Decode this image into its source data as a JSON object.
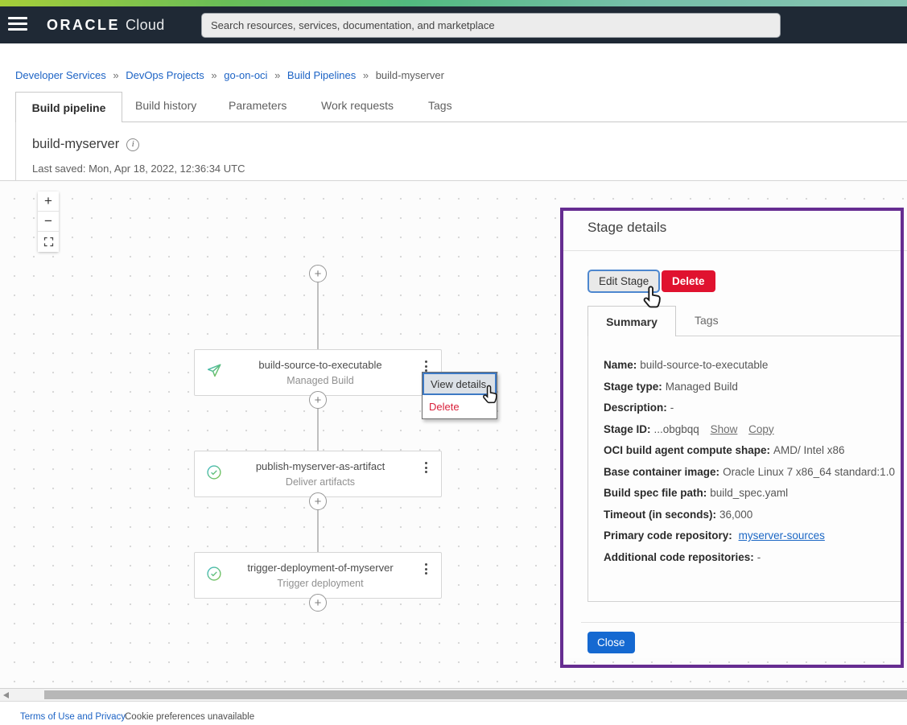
{
  "header": {
    "logo_primary": "ORACLE",
    "logo_secondary": "Cloud",
    "search_placeholder": "Search resources, services, documentation, and marketplace"
  },
  "breadcrumb": {
    "separator": "»",
    "links": [
      "Developer Services",
      "DevOps Projects",
      "go-on-oci",
      "Build Pipelines"
    ],
    "current": "build-myserver"
  },
  "tabs": [
    {
      "label": "Build pipeline",
      "active": true
    },
    {
      "label": "Build history",
      "active": false
    },
    {
      "label": "Parameters",
      "active": false
    },
    {
      "label": "Work requests",
      "active": false
    },
    {
      "label": "Tags",
      "active": false
    }
  ],
  "page": {
    "title": "build-myserver",
    "last_saved": "Last saved: Mon, Apr 18, 2022, 12:36:34 UTC"
  },
  "canvas": {
    "zoom_in": "+",
    "zoom_out": "−"
  },
  "pipeline": {
    "stages": [
      {
        "name": "build-source-to-executable",
        "type": "Managed Build",
        "icon": "send-icon"
      },
      {
        "name": "publish-myserver-as-artifact",
        "type": "Deliver artifacts",
        "icon": "check-circle-icon"
      },
      {
        "name": "trigger-deployment-of-myserver",
        "type": "Trigger deployment",
        "icon": "check-circle-icon"
      }
    ]
  },
  "context_menu": {
    "items": [
      {
        "label": "View details",
        "highlighted": true
      },
      {
        "label": "Delete",
        "danger": true
      }
    ]
  },
  "stage_details": {
    "title": "Stage details",
    "buttons": {
      "edit": "Edit Stage",
      "delete": "Delete",
      "close": "Close"
    },
    "tabs": [
      {
        "label": "Summary",
        "active": true
      },
      {
        "label": "Tags",
        "active": false
      }
    ],
    "fields": [
      {
        "label": "Name:",
        "value": "build-source-to-executable"
      },
      {
        "label": "Stage type:",
        "value": "Managed Build"
      },
      {
        "label": "Description:",
        "value": "-"
      },
      {
        "label": "Stage ID:",
        "value": "...obgbqq",
        "links": [
          "Show",
          "Copy"
        ]
      },
      {
        "label": "OCI build agent compute shape:",
        "value": "AMD/ Intel x86"
      },
      {
        "label": "Base container image:",
        "value": "Oracle Linux 7 x86_64 standard:1.0"
      },
      {
        "label": "Build spec file path:",
        "value": "build_spec.yaml"
      },
      {
        "label": "Timeout (in seconds):",
        "value": "36,000"
      },
      {
        "label": "Primary code repository:",
        "value": "myserver-sources",
        "value_is_link": true
      },
      {
        "label": "Additional code repositories:",
        "value": "-"
      }
    ]
  },
  "footer": {
    "terms": "Terms of Use and Privacy",
    "cookie": "Cookie preferences unavailable"
  },
  "colors": {
    "header_bg": "#1f2935",
    "brand_gradient": [
      "#a6ce39",
      "#52b97f",
      "#86c3b2"
    ],
    "purple_highlight": "#662d91",
    "danger_red": "#e0122f",
    "primary_blue": "#1569d1",
    "link_blue": "#1a66c4",
    "focus_blue": "#4d87cf",
    "stage_icon_gradient": [
      "#39b8c6",
      "#7dc244"
    ]
  }
}
